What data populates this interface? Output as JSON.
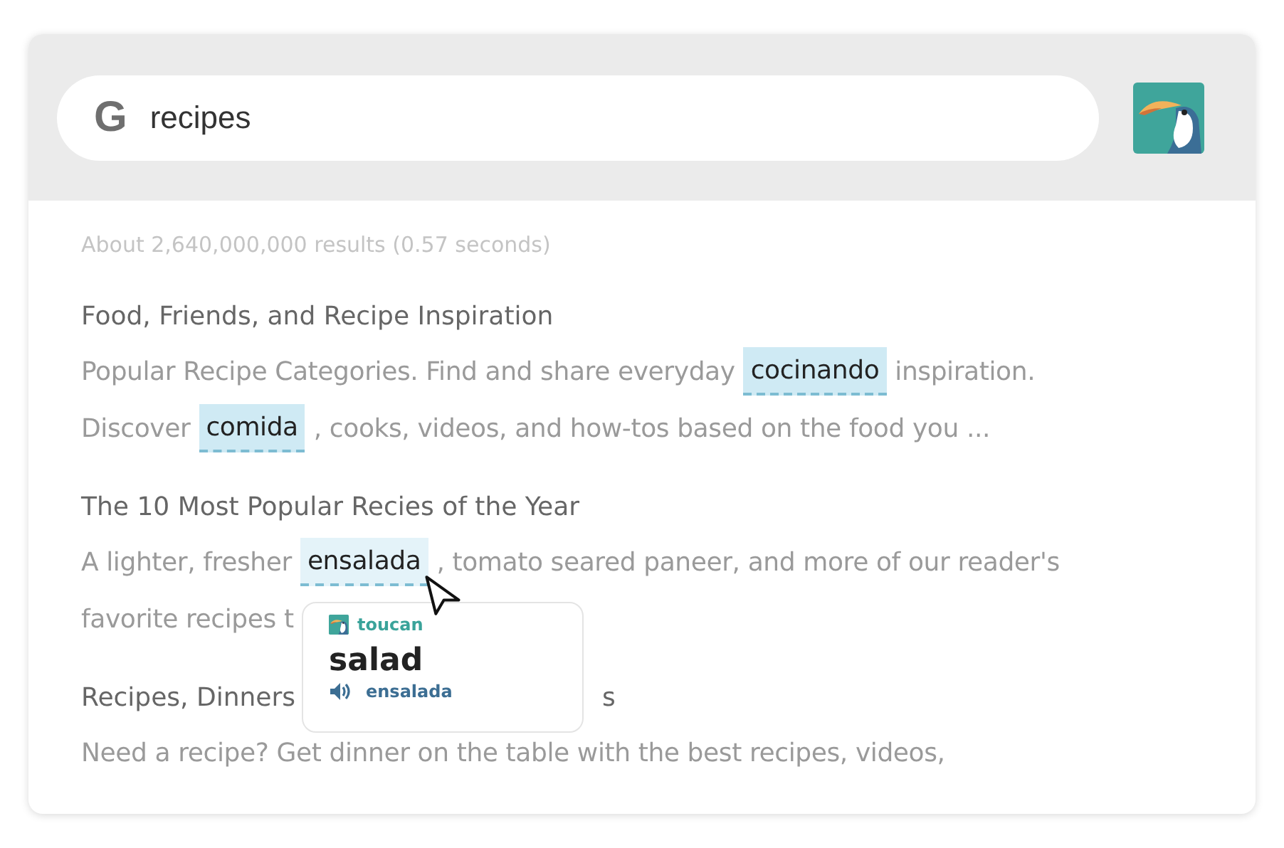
{
  "search": {
    "logo": "G",
    "value": "recipes"
  },
  "stats": "About 2,640,000,000 results (0.57 seconds)",
  "results": [
    {
      "title": "Food, Friends, and Recipe Inspiration",
      "lines": [
        [
          {
            "kind": "text",
            "text": "Popular Recipe Categories. Find and share everyday"
          },
          {
            "kind": "word",
            "text": "cocinando",
            "active": false
          },
          {
            "kind": "text",
            "text": "inspiration."
          }
        ],
        [
          {
            "kind": "text",
            "text": "Discover"
          },
          {
            "kind": "word",
            "text": "comida",
            "active": false
          },
          {
            "kind": "text",
            "text": ", cooks, videos, and how-tos based on the food you ..."
          }
        ]
      ]
    },
    {
      "title": "The 10 Most Popular Recies of the Year",
      "lines": [
        [
          {
            "kind": "text",
            "text": "A lighter, fresher"
          },
          {
            "kind": "word",
            "text": "ensalada",
            "active": true
          },
          {
            "kind": "text",
            "text": ", tomato seared paneer, and more of our reader's"
          }
        ],
        [
          {
            "kind": "text",
            "text": "favorite recipes t"
          }
        ]
      ]
    },
    {
      "title": "Recipes, Dinners",
      "title_tail": "s",
      "lines": [
        [
          {
            "kind": "text",
            "text": "Need a recipe? Get dinner on the table with the best recipes, videos,"
          }
        ]
      ]
    }
  ],
  "popup": {
    "brand": "toucan",
    "translation": "salad",
    "original": "ensalada"
  }
}
